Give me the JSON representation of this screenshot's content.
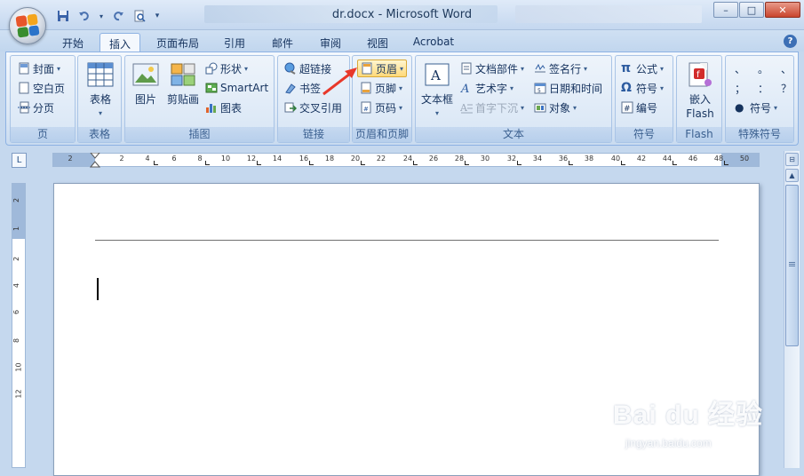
{
  "window": {
    "title": "dr.docx - Microsoft Word",
    "controls": {
      "minimize": "–",
      "maximize": "□",
      "close": "✕"
    }
  },
  "qat": {
    "save_icon": "save-icon",
    "undo_icon": "undo-icon",
    "redo_icon": "redo-icon",
    "preview_icon": "print-preview-icon",
    "more": "▾"
  },
  "tabs": [
    {
      "label": "开始"
    },
    {
      "label": "插入",
      "active": true
    },
    {
      "label": "页面布局"
    },
    {
      "label": "引用"
    },
    {
      "label": "邮件"
    },
    {
      "label": "审阅"
    },
    {
      "label": "视图"
    },
    {
      "label": "Acrobat"
    }
  ],
  "help": "?",
  "ribbon": {
    "pages": {
      "label": "页",
      "items": [
        "封面",
        "空白页",
        "分页"
      ]
    },
    "table": {
      "label": "表格",
      "button": "表格"
    },
    "illustrations": {
      "label": "插图",
      "picture": "图片",
      "clipart": "剪贴画",
      "shapes": "形状",
      "smartart": "SmartArt",
      "chart": "图表"
    },
    "links": {
      "label": "链接",
      "items": [
        "超链接",
        "书签",
        "交叉引用"
      ]
    },
    "header_footer": {
      "label": "页眉和页脚",
      "items": [
        "页眉",
        "页脚",
        "页码"
      ]
    },
    "text": {
      "label": "文本",
      "textbox": "文本框",
      "items": [
        "文档部件",
        "艺术字",
        "首字下沉",
        "签名行",
        "日期和时间",
        "对象"
      ]
    },
    "symbols": {
      "label": "符号",
      "items": [
        "公式",
        "符号",
        "编号"
      ]
    },
    "flash": {
      "label": "Flash",
      "button_line1": "嵌入",
      "button_line2": "Flash"
    },
    "special": {
      "label": "特殊符号",
      "chars": [
        "、",
        "。",
        "、",
        "；",
        "：",
        "？"
      ],
      "symbol": "符号"
    }
  },
  "ruler": {
    "corner": "L",
    "labels": [
      "2",
      "2",
      "4",
      "6",
      "8",
      "10",
      "12",
      "14",
      "16",
      "18",
      "20",
      "22",
      "24",
      "26",
      "28",
      "30",
      "32",
      "34",
      "36",
      "38",
      "40",
      "42",
      "44",
      "46",
      "48",
      "50"
    ],
    "vlabels": [
      "2",
      "1",
      "2",
      "4",
      "6",
      "8",
      "10",
      "12"
    ]
  },
  "watermark": {
    "main": "Bai du 经验",
    "sub": "jingyan.baidu.com"
  }
}
